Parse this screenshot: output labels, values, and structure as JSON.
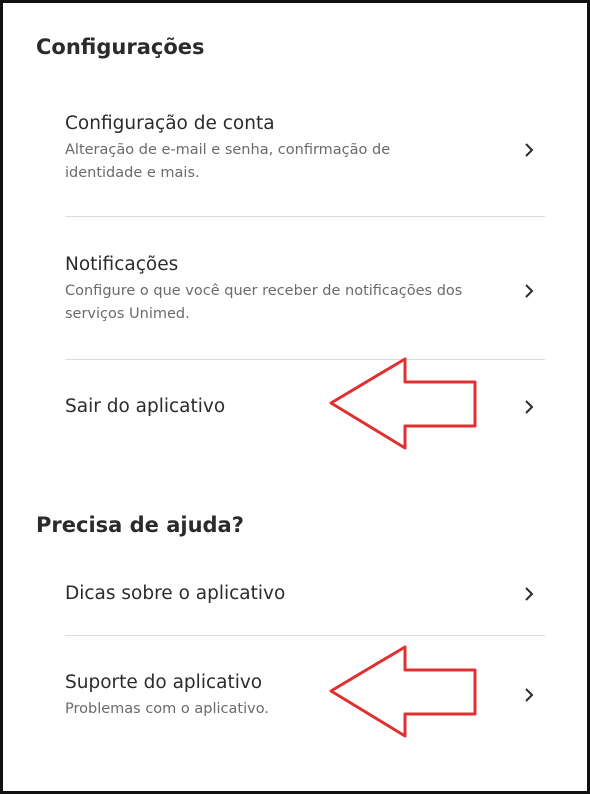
{
  "settings": {
    "section_title": "Configurações",
    "items": [
      {
        "title": "Configuração de conta",
        "description": "Alteração de e-mail e senha, confirmação de identidade e mais."
      },
      {
        "title": "Notificações",
        "description": "Configure o que você quer receber de notificações dos serviços Unimed."
      },
      {
        "title": "Sair do aplicativo"
      }
    ]
  },
  "help": {
    "section_title": "Precisa de ajuda?",
    "items": [
      {
        "title": "Dicas sobre o aplicativo"
      },
      {
        "title": "Suporte do aplicativo",
        "description": "Problemas com o aplicativo."
      }
    ]
  },
  "icons": {
    "chevron": "chevron-right-icon",
    "annotation": "arrow-left-outline"
  },
  "colors": {
    "annotation_arrow": "#e03030",
    "divider": "#dcdcdc"
  }
}
